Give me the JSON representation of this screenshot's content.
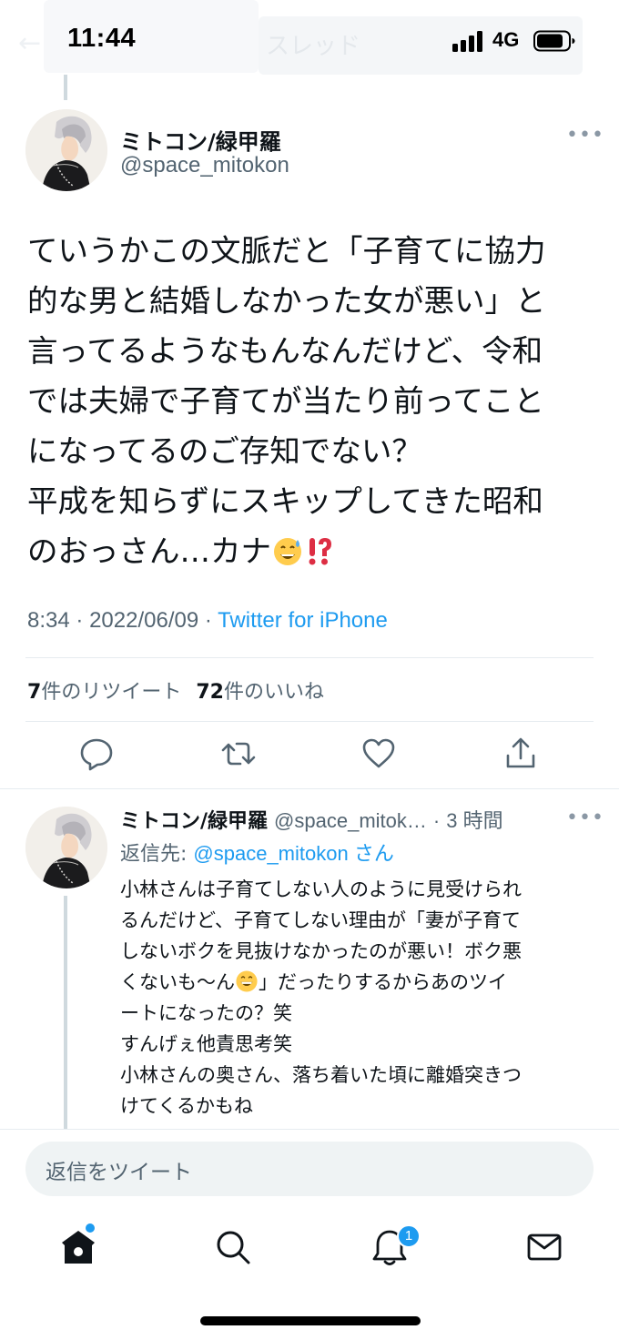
{
  "status_bar": {
    "time": "11:44",
    "network": "4G"
  },
  "ghost_header": {
    "title": "スレッド"
  },
  "tweet": {
    "author_name": "ミトコン/緑甲羅",
    "author_handle": "@space_mitokon",
    "text_lines": [
      "ていうかこの文脈だと「子育てに協力",
      "的な男と結婚しなかった女が悪い」と",
      "言ってるようなもんなんだけど、令和",
      "では夫婦で子育てが当たり前ってこと",
      "になってるのご存知でない？",
      "平成を知らずにスキップしてきた昭和",
      "のおっさん…カナ"
    ],
    "emojis": [
      "grinning-sweat-emoji",
      "exclamation-question-emoji"
    ],
    "time": "8:34",
    "date": "2022/06/09",
    "separator": "·",
    "source": "Twitter for iPhone",
    "retweet_count": "7",
    "retweet_label": "件のリツイート",
    "like_count": "72",
    "like_label": "件のいいね"
  },
  "actions": [
    "reply-icon",
    "retweet-icon",
    "like-icon",
    "share-icon"
  ],
  "reply": {
    "author_name": "ミトコン/緑甲羅",
    "author_handle": "@space_mitok…",
    "separator": "·",
    "timestamp": "3 時間",
    "reply_to_label": "返信先: ",
    "reply_to_handle": "@space_mitokon",
    "reply_to_suffix": " さん",
    "text_line1": "小林さんは子育てしない人のように見受けられ",
    "text_line2": "るんだけど、子育てしない理由が「妻が子育て",
    "text_line3": "しないボクを見抜けなかったのが悪い！ボク悪",
    "text_line4_before": "くないも〜ん",
    "text_line4_after": "」だったりするからあのツイ",
    "text_line5": "ートになったの？笑",
    "text_line6": "すんげぇ他責思考笑",
    "text_line7": "小林さんの奥さん、落ち着いた頃に離婚突きつ",
    "text_line8": "けてくるかもね"
  },
  "compose": {
    "placeholder": "返信をツイート"
  },
  "tab_bar": {
    "items": [
      "home-icon",
      "search-icon",
      "notifications-icon",
      "messages-icon"
    ],
    "notification_badge": "1"
  }
}
